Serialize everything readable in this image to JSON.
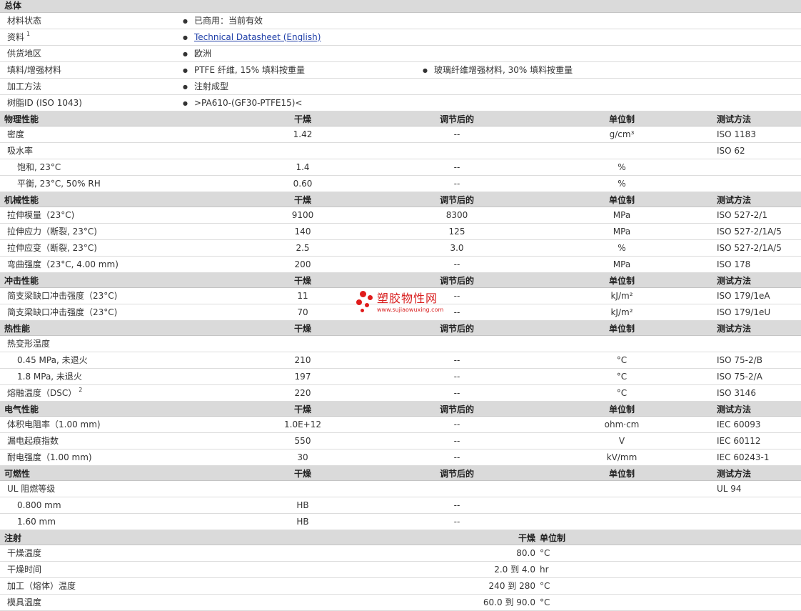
{
  "general": {
    "title": "总体",
    "rows": [
      {
        "label": "材料状态",
        "values": [
          "已商用：当前有效"
        ]
      },
      {
        "label": "资料",
        "sup": "1",
        "link": "Technical Datasheet (English)"
      },
      {
        "label": "供货地区",
        "values": [
          "欧洲"
        ]
      },
      {
        "label": "填料/增强材料",
        "values": [
          "PTFE 纤维, 15% 填料按重量",
          "玻璃纤维增强材料, 30% 填料按重量"
        ]
      },
      {
        "label": "加工方法",
        "values": [
          "注射成型"
        ]
      },
      {
        "label": "树脂ID (ISO 1043)",
        "values": [
          ">PA610-(GF30-PTFE15)<"
        ]
      }
    ]
  },
  "columns": {
    "dry": "干燥",
    "conditioned": "调节后的",
    "unit": "单位制",
    "test": "测试方法"
  },
  "sections": [
    {
      "title": "物理性能",
      "rows": [
        {
          "label": "密度",
          "dry": "1.42",
          "cond": "--",
          "unit": "g/cm³",
          "test": "ISO 1183"
        },
        {
          "label": "吸水率",
          "test": "ISO 62"
        },
        {
          "label": "饱和, 23°C",
          "indent": true,
          "dry": "1.4",
          "cond": "--",
          "unit": "%"
        },
        {
          "label": "平衡, 23°C, 50% RH",
          "indent": true,
          "dry": "0.60",
          "cond": "--",
          "unit": "%"
        }
      ]
    },
    {
      "title": "机械性能",
      "rows": [
        {
          "label": "拉伸模量（23°C)",
          "dry": "9100",
          "cond": "8300",
          "unit": "MPa",
          "test": "ISO 527-2/1"
        },
        {
          "label": "拉伸应力（断裂, 23°C)",
          "dry": "140",
          "cond": "125",
          "unit": "MPa",
          "test": "ISO 527-2/1A/5"
        },
        {
          "label": "拉伸应变（断裂, 23°C)",
          "dry": "2.5",
          "cond": "3.0",
          "unit": "%",
          "test": "ISO 527-2/1A/5"
        },
        {
          "label": "弯曲强度（23°C, 4.00 mm)",
          "dry": "200",
          "cond": "--",
          "unit": "MPa",
          "test": "ISO 178"
        }
      ]
    },
    {
      "title": "冲击性能",
      "rows": [
        {
          "label": "简支梁缺口冲击强度（23°C)",
          "dry": "11",
          "cond": "--",
          "unit": "kJ/m²",
          "test": "ISO 179/1eA"
        },
        {
          "label": "简支梁缺口冲击强度（23°C)",
          "dry": "70",
          "cond": "--",
          "unit": "kJ/m²",
          "test": "ISO 179/1eU"
        }
      ]
    },
    {
      "title": "热性能",
      "rows": [
        {
          "label": "热变形温度"
        },
        {
          "label": "0.45 MPa, 未退火",
          "indent": true,
          "dry": "210",
          "cond": "--",
          "unit": "°C",
          "test": "ISO 75-2/B"
        },
        {
          "label": "1.8 MPa, 未退火",
          "indent": true,
          "dry": "197",
          "cond": "--",
          "unit": "°C",
          "test": "ISO 75-2/A"
        },
        {
          "label": "熔融温度（DSC）",
          "sup": "2",
          "dry": "220",
          "cond": "--",
          "unit": "°C",
          "test": "ISO 3146"
        }
      ]
    },
    {
      "title": "电气性能",
      "rows": [
        {
          "label": "体积电阻率（1.00 mm)",
          "dry": "1.0E+12",
          "cond": "--",
          "unit": "ohm·cm",
          "test": "IEC 60093"
        },
        {
          "label": "漏电起痕指数",
          "dry": "550",
          "cond": "--",
          "unit": "V",
          "test": "IEC 60112"
        },
        {
          "label": "耐电强度（1.00 mm)",
          "dry": "30",
          "cond": "--",
          "unit": "kV/mm",
          "test": "IEC 60243-1"
        }
      ]
    },
    {
      "title": "可燃性",
      "rows": [
        {
          "label": "UL 阻燃等级",
          "test": "UL 94"
        },
        {
          "label": "0.800 mm",
          "indent": true,
          "dry": "HB",
          "cond": "--"
        },
        {
          "label": "1.60 mm",
          "indent": true,
          "dry": "HB",
          "cond": "--"
        }
      ]
    }
  ],
  "injection": {
    "title": "注射",
    "dry_header": "干燥",
    "unit_header": "单位制",
    "rows": [
      {
        "label": "干燥温度",
        "value": "80.0",
        "unit": "°C"
      },
      {
        "label": "干燥时间",
        "value": "2.0 到 4.0",
        "unit": "hr"
      },
      {
        "label": "加工（熔体）温度",
        "value": "240 到 280",
        "unit": "°C"
      },
      {
        "label": "模具温度",
        "value": "60.0 到 90.0",
        "unit": "°C"
      }
    ]
  },
  "watermark": {
    "title": "塑胶物性网",
    "url": "www.sujiaowuxing.com",
    "color": "#d81e1e"
  }
}
